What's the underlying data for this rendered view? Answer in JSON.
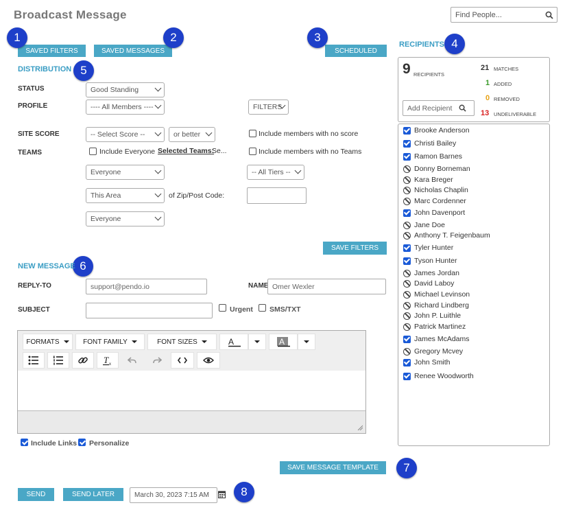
{
  "header": {
    "title": "Broadcast Message",
    "search_placeholder": "Find People..."
  },
  "toolbar": {
    "saved_filters": "SAVED FILTERS",
    "saved_messages": "SAVED MESSAGES",
    "scheduled": "SCHEDULED"
  },
  "callouts": [
    "1",
    "2",
    "3",
    "4",
    "5",
    "6",
    "7",
    "8"
  ],
  "distribution": {
    "heading": "DISTRIBUTION",
    "status_label": "STATUS",
    "status_value": "Good Standing",
    "profile_label": "PROFILE",
    "profile_value": "---- All Members ----",
    "filters_label": "FILTERS",
    "site_score_label": "SITE SCORE",
    "score_value": "-- Select Score --",
    "score_mod": "or better",
    "no_score_label": "Include members with no score",
    "teams_label": "TEAMS",
    "include_everyone_label": "Include Everyone",
    "selected_teams_label": "Selected Teams:",
    "selected_teams_value": "Se...",
    "no_teams_label": "Include members with no Teams",
    "teams_select": "Everyone",
    "tiers_select": "-- All Tiers --",
    "area_select": "This Area",
    "zip_label": "of Zip/Post Code:",
    "zip_value": "",
    "third_select": "Everyone",
    "save_filters": "SAVE FILTERS"
  },
  "message": {
    "heading": "NEW MESSAGE",
    "reply_to_label": "REPLY-TO",
    "reply_to_value": "support@pendo.io",
    "name_label": "NAME",
    "name_value": "Omer Wexler",
    "subject_label": "SUBJECT",
    "subject_value": "",
    "urgent_label": "Urgent",
    "sms_label": "SMS/TXT",
    "editor": {
      "formats": "FORMATS",
      "font_family": "FONT FAMILY",
      "font_sizes": "FONT SIZES"
    },
    "include_links_label": "Include Links",
    "personalize_label": "Personalize",
    "save_template": "SAVE MESSAGE TEMPLATE",
    "send": "SEND",
    "send_later": "SEND LATER",
    "schedule_date": "March 30, 2023 7:15 AM"
  },
  "recipients": {
    "heading": "RECIPIENTS",
    "count": "9",
    "count_label": "RECIPIENTS",
    "matches": "21",
    "matches_label": "MATCHES",
    "added": "1",
    "added_label": "ADDED",
    "removed": "0",
    "removed_label": "REMOVED",
    "undeliverable": "13",
    "undeliverable_label": "UNDELIVERABLE",
    "add_placeholder": "Add Recipient",
    "colors": {
      "added": "#3a9a2a",
      "removed": "#e8a317",
      "undeliverable": "#d92020"
    },
    "people": [
      {
        "name": "Brooke Anderson",
        "state": "checked"
      },
      {
        "name": "Christi Bailey",
        "state": "checked"
      },
      {
        "name": "Ramon Barnes",
        "state": "checked"
      },
      {
        "name": "Donny Borneman",
        "state": "blocked"
      },
      {
        "name": "Kara Breger",
        "state": "blocked"
      },
      {
        "name": "Nicholas Chaplin",
        "state": "blocked"
      },
      {
        "name": "Marc Cordenner",
        "state": "blocked"
      },
      {
        "name": "John Davenport",
        "state": "checked"
      },
      {
        "name": "Jane Doe",
        "state": "blocked"
      },
      {
        "name": "Anthony T. Feigenbaum",
        "state": "blocked"
      },
      {
        "name": "Tyler Hunter",
        "state": "checked"
      },
      {
        "name": "Tyson Hunter",
        "state": "checked"
      },
      {
        "name": "James Jordan",
        "state": "blocked"
      },
      {
        "name": "David Laboy",
        "state": "blocked"
      },
      {
        "name": "Michael Levinson",
        "state": "blocked"
      },
      {
        "name": "Richard Lindberg",
        "state": "blocked"
      },
      {
        "name": "John P. Luithle",
        "state": "blocked"
      },
      {
        "name": "Patrick Martinez",
        "state": "blocked"
      },
      {
        "name": "James McAdams",
        "state": "checked"
      },
      {
        "name": "Gregory Mcvey",
        "state": "blocked"
      },
      {
        "name": "John Smith",
        "state": "checked"
      },
      {
        "name": "Renee Woodworth",
        "state": "checked"
      }
    ]
  }
}
